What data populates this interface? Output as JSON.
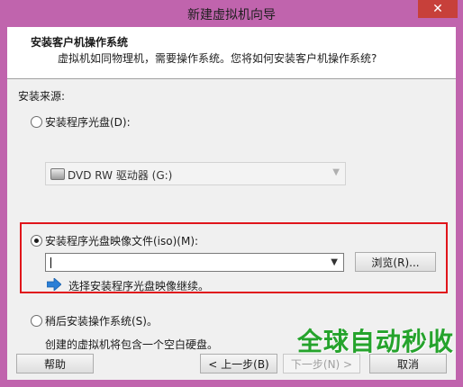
{
  "window": {
    "title": "新建虚拟机向导",
    "close_glyph": "✕"
  },
  "header": {
    "title": "安装客户机操作系统",
    "subtitle": "虚拟机如同物理机，需要操作系统。您将如何安装客户机操作系统?"
  },
  "install_source": {
    "label": "安装来源:",
    "options": [
      {
        "label": "安装程序光盘(D):",
        "selected": false
      },
      {
        "label": "安装程序光盘映像文件(iso)(M):",
        "selected": true
      },
      {
        "label": "稍后安装操作系统(S)。",
        "selected": false
      }
    ],
    "disc_drive": {
      "value": "DVD RW 驱动器 (G:)"
    },
    "iso_path": {
      "value": ""
    },
    "browse_label": "浏览(R)...",
    "info_text": "选择安装程序光盘映像继续。",
    "later_desc": "创建的虚拟机将包含一个空白硬盘。"
  },
  "footer": {
    "help_label": "帮助",
    "back_label": "< 上一步(B)",
    "next_label": "下一步(N) >",
    "cancel_label": "取消"
  },
  "watermark": "全球自动秒收",
  "colors": {
    "frame": "#c064ad",
    "highlight": "#e0151b",
    "info_arrow": "#2b7fd6",
    "watermark": "#25a32c"
  }
}
